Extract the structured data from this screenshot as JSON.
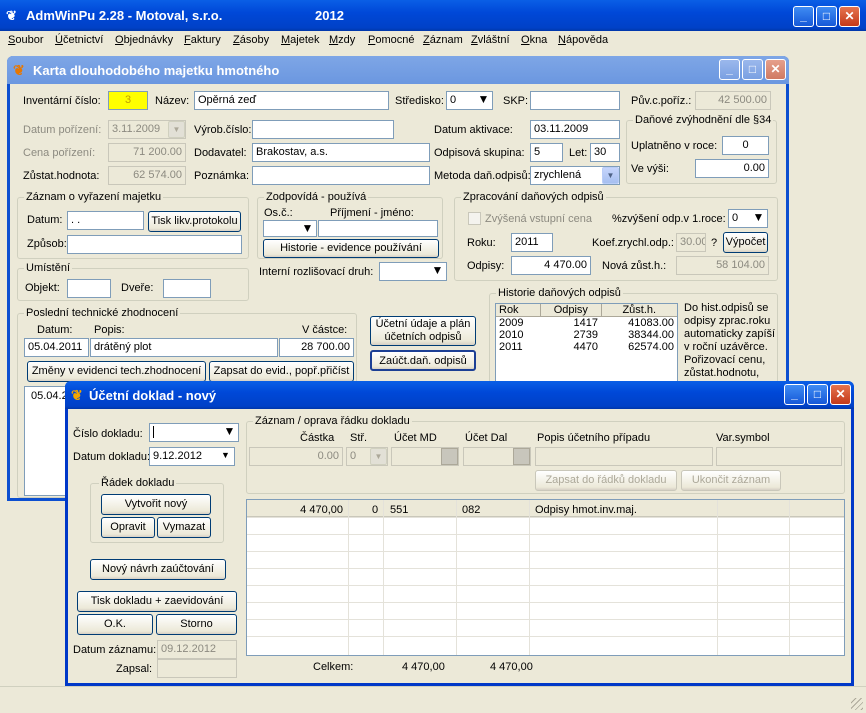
{
  "app": {
    "title": "AdmWinPu 2.28 - Motoval, s.r.o.",
    "year": "2012",
    "minimize": "_",
    "maximize": "□",
    "close": "✕"
  },
  "menu": [
    "Soubor",
    "Účetnictví",
    "Objednávky",
    "Faktury",
    "Zásoby",
    "Majetek",
    "Mzdy",
    "Pomocné",
    "Záznam",
    "Zvláštní",
    "Okna",
    "Nápověda"
  ],
  "card": {
    "title": "Karta dlouhodobého majetku hmotného",
    "inv_label": "Inventární číslo:",
    "inv_value": "3",
    "name_label": "Název:",
    "name_value": "Opěrná zeď",
    "stredisko_label": "Středisko:",
    "stredisko_value": "0",
    "skp_label": "SKP:",
    "skp_value": "",
    "puv_label": "Pův.c.poříz.:",
    "puv_value": "42 500.00",
    "datum_poriz_label": "Datum pořízení:",
    "datum_poriz_value": "3.11.2009",
    "vyrob_label": "Výrob.číslo:",
    "vyrob_value": "",
    "datum_akt_label": "Datum aktivace:",
    "datum_akt_value": "03.11.2009",
    "cena_label": "Cena pořízení:",
    "cena_value": "71 200.00",
    "dodavatel_label": "Dodavatel:",
    "dodavatel_value": "Brakostav, a.s.",
    "odpis_sk_label": "Odpisová skupina:",
    "odpis_sk_value": "5",
    "let_label": "Let:",
    "let_value": "30",
    "zustat_label": "Zůstat.hodnota:",
    "zustat_value": "62 574.00",
    "poznamka_label": "Poznámka:",
    "poznamka_value": "",
    "metoda_label": "Metoda daň.odpisů:",
    "metoda_value": "zrychlená",
    "danove": {
      "title": "Daňové zvýhodnění dle §34",
      "uplatneno_label": "Uplatněno v roce:",
      "uplatneno_value": "0",
      "vevysi_label": "Ve výši:",
      "vevysi_value": "0.00"
    },
    "vyrazeni": {
      "title": "Záznam o vyřazení majetku",
      "datum_label": "Datum:",
      "datum_value": " .  .",
      "tisk_btn": "Tisk likv.protokolu",
      "zpusob_label": "Způsob:",
      "zpusob_value": ""
    },
    "zodpovida": {
      "title": "Zodpovídá - používá",
      "osc_label": "Os.č.:",
      "prijmeni_label": "Příjmení - jméno:",
      "historie_btn": "Historie - evidence používání"
    },
    "umisteni": {
      "title": "Umístění",
      "objekt_label": "Objekt:",
      "dvere_label": "Dveře:"
    },
    "interni_label": "Interní rozlišovací druh:",
    "zpracovani": {
      "title": "Zpracování daňových odpisů",
      "zvysena_label": "Zvýšená vstupní cena",
      "zvyseni_label": "%zvýšení odp.v 1.roce:",
      "zvyseni_value": "0",
      "roku_label": "Roku:",
      "roku_value": "2011",
      "koef_label": "Koef.zrychl.odp.:",
      "koef_value": "30.00",
      "q": "?",
      "vypocet_btn": "Výpočet",
      "odpisy_label": "Odpisy:",
      "odpisy_value": "4 470.00",
      "nova_label": "Nová zůst.h.:",
      "nova_value": "58 104.00"
    },
    "tech": {
      "title": "Poslední technické zhodnocení",
      "datum_label": "Datum:",
      "popis_label": "Popis:",
      "castka_label": "V částce:",
      "datum_value": "05.04.2011",
      "popis_value": "drátěný plot",
      "castka_value": "28 700.00",
      "zmeny_btn": "Změny v evidenci tech.zhodnocení",
      "zapsat_btn": "Zapsat do evid., popř.přičíst",
      "list_value": "05.04.2"
    },
    "ucetni_btn": "Účetní údaje a plán účetních odpisů",
    "zauct_btn": "Zaúčt.daň. odpisů",
    "historie": {
      "title": "Historie daňových odpisů",
      "headers": [
        "Rok",
        "Odpisy",
        "Zůst.h."
      ],
      "rows": [
        [
          "2009",
          "1417",
          "41083.00"
        ],
        [
          "2010",
          "2739",
          "38344.00"
        ],
        [
          "2011",
          "4470",
          "62574.00"
        ]
      ],
      "note": "Do hist.odpisů se odpisy zprac.roku automaticky zapíší v roční uzávěrce. Pořizovací cenu, zůstat.hodnotu,"
    }
  },
  "doklad": {
    "title": "Účetní doklad - nový",
    "cislo_label": "Číslo dokladu:",
    "cislo_value": "",
    "datum_label": "Datum dokladu:",
    "datum_value": "9.12.2012",
    "radek": {
      "title": "Řádek dokladu",
      "vytvorit": "Vytvořit nový",
      "opravit": "Opravit",
      "vymazat": "Vymazat"
    },
    "novy_navrh": "Nový návrh zaúčtování",
    "tisk": "Tisk dokladu + zaevidování",
    "ok": "O.K.",
    "storno": "Storno",
    "datum_zaz_label": "Datum záznamu:",
    "datum_zaz_value": "09.12.2012",
    "zapsal_label": "Zapsal:",
    "zapsal_value": "",
    "zaznam": {
      "title": "Záznam / oprava řádku dokladu",
      "castka_label": "Částka",
      "str_label": "Stř.",
      "md_label": "Účet MD",
      "dal_label": "Účet Dal",
      "popis_label": "Popis účetního případu",
      "var_label": "Var.symbol",
      "castka_value": "0.00",
      "str_value": "0",
      "zapsat_btn": "Zapsat do řádků dokladu",
      "ukoncit_btn": "Ukončit záznam"
    },
    "rows": [
      {
        "castka": "4 470,00",
        "str": "0",
        "md": "551",
        "dal": "082",
        "popis": "Odpisy hmot.inv.maj.",
        "var": ""
      }
    ],
    "celkem_label": "Celkem:",
    "celkem_md": "4 470,00",
    "celkem_dal": "4 470,00"
  }
}
